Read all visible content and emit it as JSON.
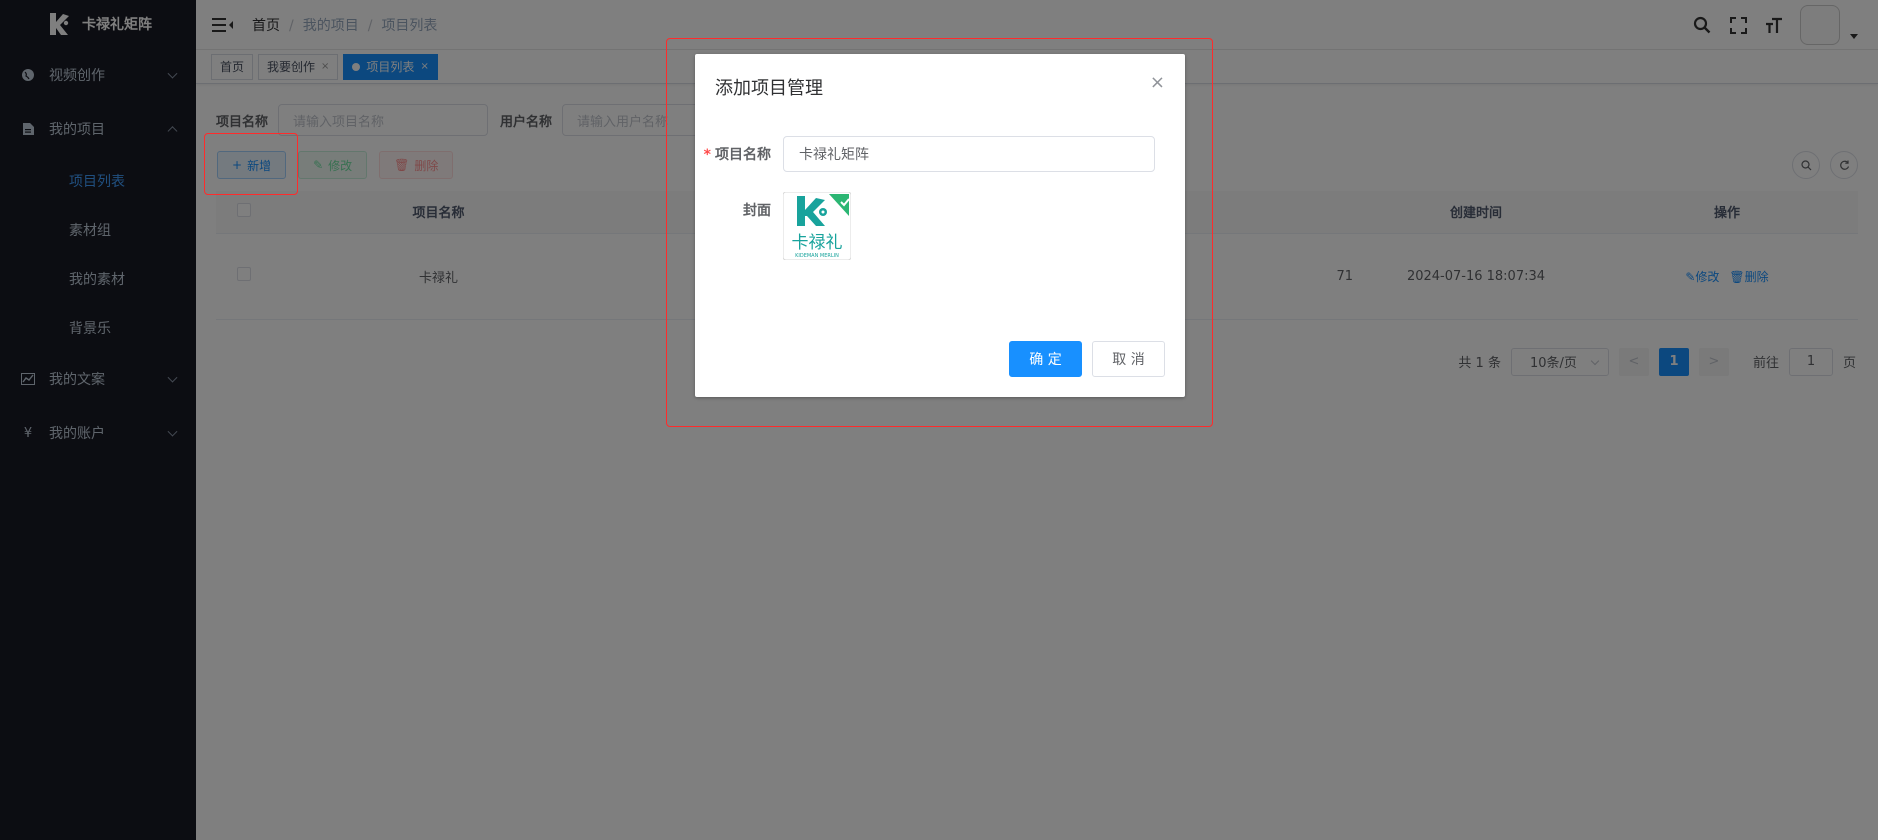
{
  "app": {
    "name": "卡禄礼矩阵"
  },
  "sidebar": {
    "items": [
      {
        "label": "视频创作",
        "icon": "globe-icon"
      },
      {
        "label": "我的项目",
        "icon": "document-icon"
      },
      {
        "label": "我的文案",
        "icon": "chart-icon"
      },
      {
        "label": "我的账户",
        "icon": "yen-icon"
      }
    ],
    "sub_items": [
      "项目列表",
      "素材组",
      "我的素材",
      "背景乐"
    ]
  },
  "breadcrumb": [
    "首页",
    "我的项目",
    "项目列表"
  ],
  "tags": [
    "首页",
    "我要创作",
    "项目列表"
  ],
  "search": {
    "project_label": "项目名称",
    "project_placeholder": "请输入项目名称",
    "user_label": "用户名称",
    "user_placeholder": "请输入用户名称"
  },
  "toolbar": {
    "add": "新增",
    "edit": "修改",
    "delete": "删除"
  },
  "table": {
    "headers": {
      "name": "项目名称",
      "created": "创建时间",
      "actions": "操作"
    },
    "rows": [
      {
        "name": "卡禄礼",
        "partial": "71",
        "created": "2024-07-16 18:07:34",
        "edit": "修改",
        "delete": "删除"
      }
    ]
  },
  "pagination": {
    "total": "共 1 条",
    "page_size": "10条/页",
    "current": "1",
    "prev": "<",
    "next": ">",
    "goto_prefix": "前往",
    "goto_value": "1",
    "goto_suffix": "页"
  },
  "dialog": {
    "title": "添加项目管理",
    "close": "×",
    "name_label": "项目名称",
    "name_value": "卡禄礼矩阵",
    "cover_label": "封面",
    "cover_text": "卡禄礼",
    "cover_sub": "KIDEMAN MERLIN",
    "confirm": "确 定",
    "cancel": "取 消"
  },
  "colors": {
    "primary": "#1890ff",
    "sidebar": "#191b24",
    "highlight": "#ff2b2b",
    "cover_teal": "#18a39c",
    "cover_green": "#2bb673"
  }
}
